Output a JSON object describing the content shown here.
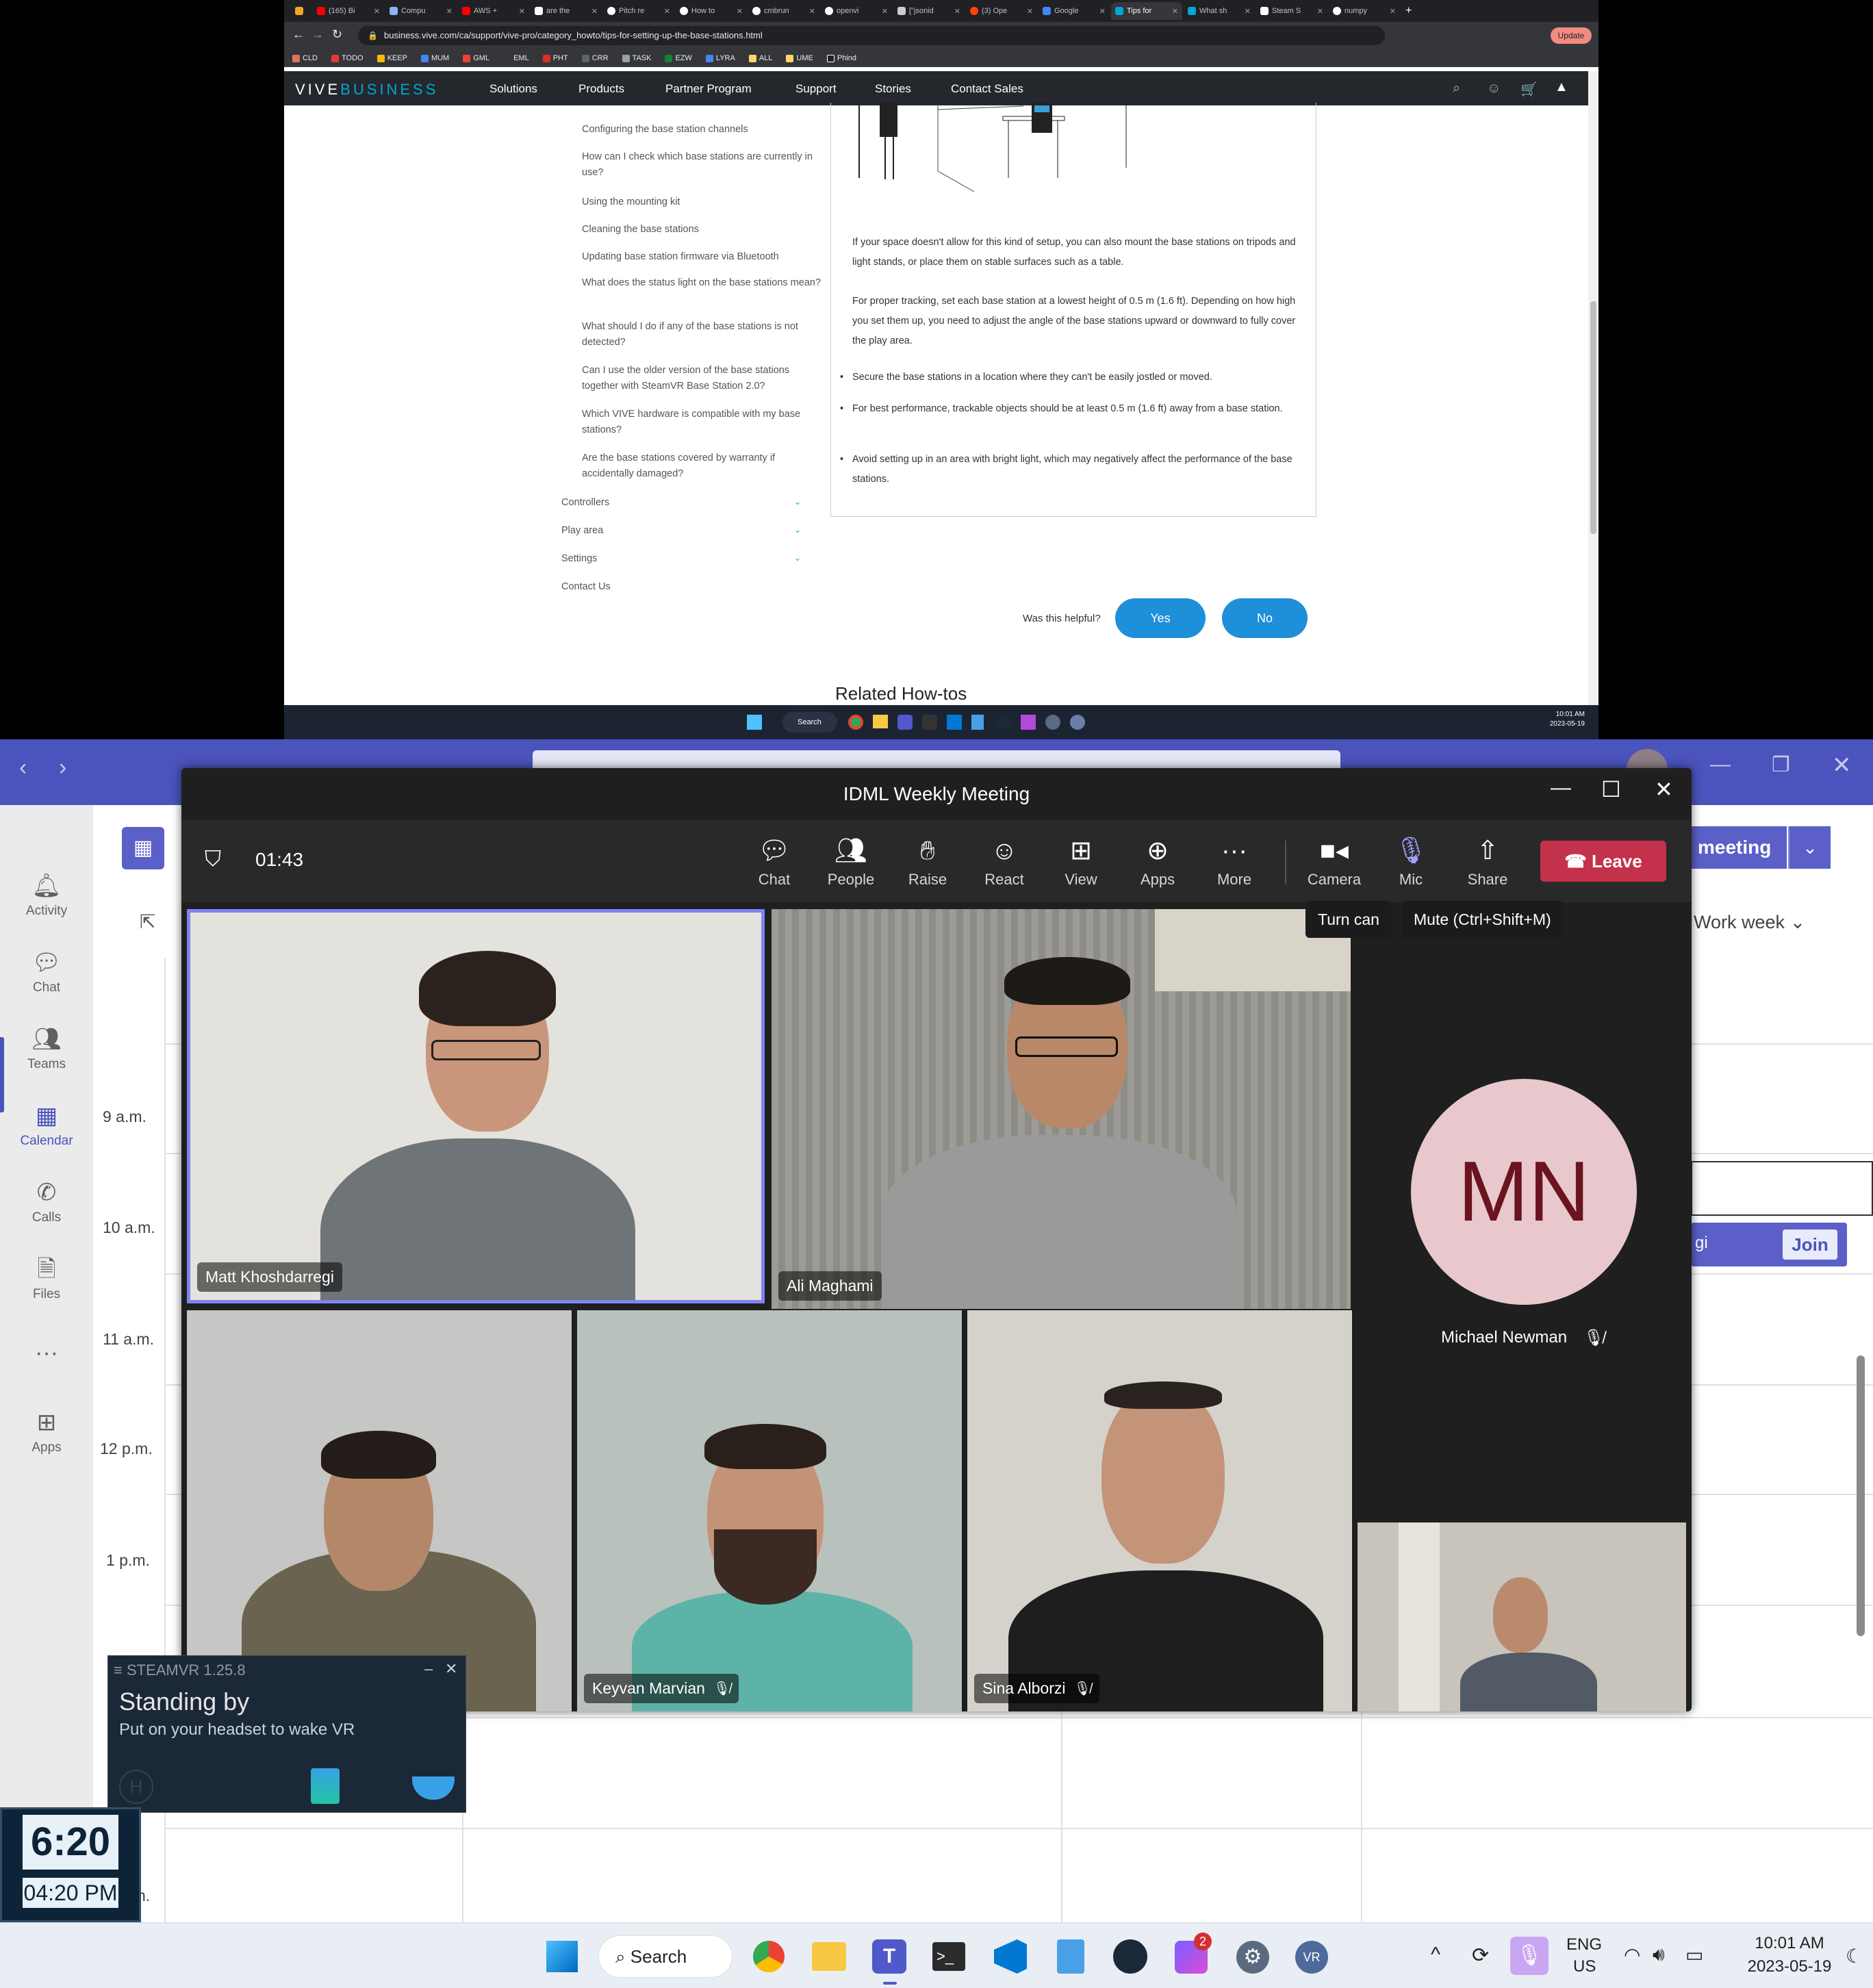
{
  "browser": {
    "tabs": [
      "(165) Bi",
      "Compu",
      "AWS + ",
      "are the",
      "Pitch re",
      "How to",
      "cmbrun",
      "openvi",
      "[\"jsonid",
      "(3) Ope",
      "Google",
      "Tips for",
      "What sh",
      "Steam S",
      "numpy"
    ],
    "url": "business.vive.com/ca/support/vive-pro/category_howto/tips-for-setting-up-the-base-stations.html",
    "bookmarks": [
      "CLD",
      "TODO",
      "KEEP",
      "MUM",
      "GML",
      "EML",
      "PHT",
      "CRR",
      "TASK",
      "EZW",
      "LYRA",
      "ALL",
      "UME",
      "Phind"
    ],
    "update_label": "Update"
  },
  "site": {
    "logo_a": "VIVE",
    "logo_b": "BUSINESS",
    "nav": [
      "Solutions",
      "Products",
      "Partner Program",
      "Support",
      "Stories",
      "Contact Sales"
    ],
    "side_links": [
      "Configuring the base station channels",
      "How can I check which base stations are currently in use?",
      "Using the mounting kit",
      "Cleaning the base stations",
      "Updating base station firmware via Bluetooth",
      "What does the status light on the base stations mean?",
      "What should I do if any of the base stations is not detected?",
      "Can I use the older version of the base stations together with SteamVR Base Station 2.0?",
      "Which VIVE hardware is compatible with my base stations?",
      "Are the base stations covered by warranty if accidentally damaged?"
    ],
    "categories": [
      "Controllers",
      "Play area",
      "Settings",
      "Contact Us"
    ],
    "para1": "If your space doesn't allow for this kind of setup, you can also mount the base stations on tripods and light stands, or place them on stable surfaces such as a table.",
    "para2": "For proper tracking, set each base station at a lowest height of 0.5 m (1.6 ft). Depending on how high you set them up, you need to adjust the angle of the base stations upward or downward to fully cover the play area.",
    "bullets": [
      "Secure the base stations in a location where they can't be easily jostled or moved.",
      "For best performance, trackable objects should be at least 0.5 m (1.6 ft) away from a base station.",
      "Avoid setting up in an area with bright light, which may negatively affect the performance of the base stations."
    ],
    "helpful_q": "Was this helpful?",
    "yes": "Yes",
    "no": "No",
    "related": "Related How-tos"
  },
  "top_taskbar": {
    "search": "Search",
    "time": "10:01 AM",
    "date": "2023-05-19"
  },
  "teams": {
    "rail": [
      "Activity",
      "Chat",
      "Teams",
      "Calendar",
      "Calls",
      "Files",
      "Apps"
    ],
    "times": [
      "9 a.m.",
      "10 a.m.",
      "11 a.m.",
      "12 p.m.",
      "1 p.m.",
      "n."
    ],
    "meet_btn": "meeting",
    "work_week": "Work week",
    "join": "Join",
    "event_partial": "gi"
  },
  "meeting": {
    "title": "IDML Weekly Meeting",
    "timer": "01:43",
    "tools": [
      "Chat",
      "People",
      "Raise",
      "React",
      "View",
      "Apps",
      "More",
      "Camera",
      "Mic",
      "Share"
    ],
    "leave": "Leave",
    "tooltip_camera": "Turn can",
    "tooltip_mic": "Mute (Ctrl+Shift+M)",
    "participants": [
      "Matt Khoshdarregi",
      "Ali Maghami",
      "Keyvan Marvian",
      "Sina Alborzi",
      "Michael Newman"
    ],
    "initials": "MN",
    "colors": {
      "leave": "#c4314b",
      "accent": "#4b53bc",
      "avatar_bg": "#e8c8cc",
      "avatar_text": "#6b1420"
    }
  },
  "steamvr": {
    "title": "STEAMVR 1.25.8",
    "status": "Standing by",
    "hint": "Put on your headset to wake VR"
  },
  "clock": {
    "big": "6:20",
    "small": "04:20 PM"
  },
  "taskbar": {
    "search": "Search",
    "lang1": "ENG",
    "lang2": "US",
    "time": "10:01 AM",
    "date": "2023-05-19",
    "badge": "2"
  }
}
